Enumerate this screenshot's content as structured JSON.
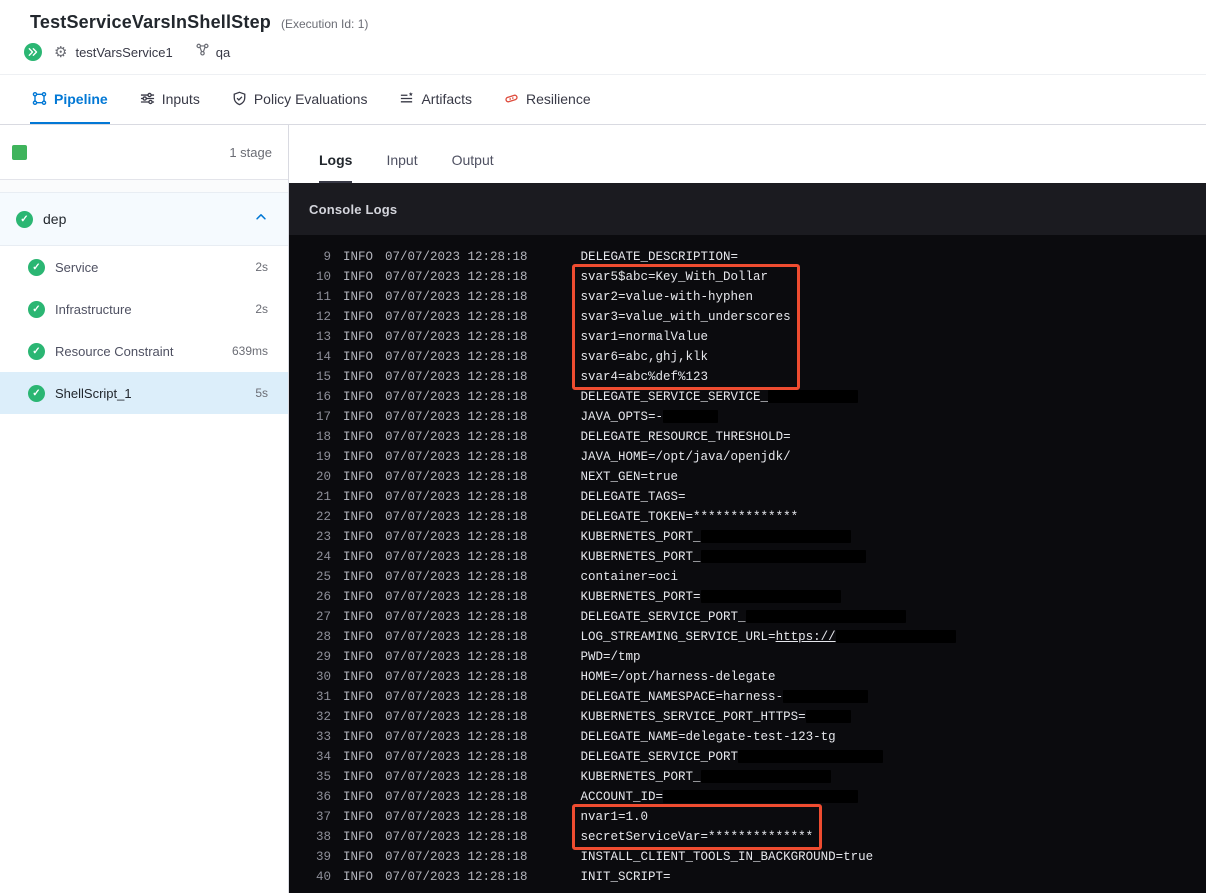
{
  "colors": {
    "accent_blue": "#0278d5",
    "success_green": "#2bb673",
    "highlight_red": "#ef4c30"
  },
  "header": {
    "title": "TestServiceVarsInShellStep",
    "execution_id": "(Execution Id: 1)",
    "service_name": "testVarsService1",
    "environment_name": "qa"
  },
  "tabs": [
    {
      "label": "Pipeline",
      "active": true
    },
    {
      "label": "Inputs",
      "active": false
    },
    {
      "label": "Policy Evaluations",
      "active": false
    },
    {
      "label": "Artifacts",
      "active": false
    },
    {
      "label": "Resilience",
      "active": false
    }
  ],
  "sidebar": {
    "stage_count": "1 stage",
    "group": {
      "label": "dep"
    },
    "items": [
      {
        "label": "Service",
        "duration": "2s",
        "selected": false
      },
      {
        "label": "Infrastructure",
        "duration": "2s",
        "selected": false
      },
      {
        "label": "Resource Constraint",
        "duration": "639ms",
        "selected": false
      },
      {
        "label": "ShellScript_1",
        "duration": "5s",
        "selected": true
      }
    ]
  },
  "console": {
    "tabs": [
      {
        "label": "Logs",
        "active": true
      },
      {
        "label": "Input",
        "active": false
      },
      {
        "label": "Output",
        "active": false
      }
    ],
    "header_label": "Console Logs",
    "highlights": [
      {
        "from": 10,
        "to": 15
      },
      {
        "from": 37,
        "to": 38
      }
    ],
    "lines": [
      {
        "n": 9,
        "level": "INFO",
        "ts": "07/07/2023 12:28:18",
        "parts": [
          {
            "text": "DELEGATE_DESCRIPTION="
          }
        ]
      },
      {
        "n": 10,
        "level": "INFO",
        "ts": "07/07/2023 12:28:18",
        "parts": [
          {
            "text": "svar5$abc=Key_With_Dollar"
          }
        ]
      },
      {
        "n": 11,
        "level": "INFO",
        "ts": "07/07/2023 12:28:18",
        "parts": [
          {
            "text": "svar2=value-with-hyphen"
          }
        ]
      },
      {
        "n": 12,
        "level": "INFO",
        "ts": "07/07/2023 12:28:18",
        "parts": [
          {
            "text": "svar3=value_with_underscores"
          }
        ]
      },
      {
        "n": 13,
        "level": "INFO",
        "ts": "07/07/2023 12:28:18",
        "parts": [
          {
            "text": "svar1=normalValue"
          }
        ]
      },
      {
        "n": 14,
        "level": "INFO",
        "ts": "07/07/2023 12:28:18",
        "parts": [
          {
            "text": "svar6=abc,ghj,klk"
          }
        ]
      },
      {
        "n": 15,
        "level": "INFO",
        "ts": "07/07/2023 12:28:18",
        "parts": [
          {
            "text": "svar4=abc%def%123"
          }
        ]
      },
      {
        "n": 16,
        "level": "INFO",
        "ts": "07/07/2023 12:28:18",
        "parts": [
          {
            "text": "DELEGATE_SERVICE_SERVICE_"
          },
          {
            "redact": 90
          }
        ]
      },
      {
        "n": 17,
        "level": "INFO",
        "ts": "07/07/2023 12:28:18",
        "parts": [
          {
            "text": "JAVA_OPTS=-"
          },
          {
            "redact": 55
          }
        ]
      },
      {
        "n": 18,
        "level": "INFO",
        "ts": "07/07/2023 12:28:18",
        "parts": [
          {
            "text": "DELEGATE_RESOURCE_THRESHOLD="
          }
        ]
      },
      {
        "n": 19,
        "level": "INFO",
        "ts": "07/07/2023 12:28:18",
        "parts": [
          {
            "text": "JAVA_HOME=/opt/java/openjdk/"
          }
        ]
      },
      {
        "n": 20,
        "level": "INFO",
        "ts": "07/07/2023 12:28:18",
        "parts": [
          {
            "text": "NEXT_GEN=true"
          }
        ]
      },
      {
        "n": 21,
        "level": "INFO",
        "ts": "07/07/2023 12:28:18",
        "parts": [
          {
            "text": "DELEGATE_TAGS="
          }
        ]
      },
      {
        "n": 22,
        "level": "INFO",
        "ts": "07/07/2023 12:28:18",
        "parts": [
          {
            "text": "DELEGATE_TOKEN=**************"
          }
        ]
      },
      {
        "n": 23,
        "level": "INFO",
        "ts": "07/07/2023 12:28:18",
        "parts": [
          {
            "text": "KUBERNETES_PORT_"
          },
          {
            "redact": 150
          }
        ]
      },
      {
        "n": 24,
        "level": "INFO",
        "ts": "07/07/2023 12:28:18",
        "parts": [
          {
            "text": "KUBERNETES_PORT_"
          },
          {
            "redact": 165
          }
        ]
      },
      {
        "n": 25,
        "level": "INFO",
        "ts": "07/07/2023 12:28:18",
        "parts": [
          {
            "text": "container=oci"
          }
        ]
      },
      {
        "n": 26,
        "level": "INFO",
        "ts": "07/07/2023 12:28:18",
        "parts": [
          {
            "text": "KUBERNETES_PORT="
          },
          {
            "redact": 140
          }
        ]
      },
      {
        "n": 27,
        "level": "INFO",
        "ts": "07/07/2023 12:28:18",
        "parts": [
          {
            "text": "DELEGATE_SERVICE_PORT_"
          },
          {
            "redact": 160
          }
        ]
      },
      {
        "n": 28,
        "level": "INFO",
        "ts": "07/07/2023 12:28:18",
        "parts": [
          {
            "text": "LOG_STREAMING_SERVICE_URL="
          },
          {
            "link": "https://"
          },
          {
            "redact": 120
          }
        ]
      },
      {
        "n": 29,
        "level": "INFO",
        "ts": "07/07/2023 12:28:18",
        "parts": [
          {
            "text": "PWD=/tmp"
          }
        ]
      },
      {
        "n": 30,
        "level": "INFO",
        "ts": "07/07/2023 12:28:18",
        "parts": [
          {
            "text": "HOME=/opt/harness-delegate"
          }
        ]
      },
      {
        "n": 31,
        "level": "INFO",
        "ts": "07/07/2023 12:28:18",
        "parts": [
          {
            "text": "DELEGATE_NAMESPACE=harness-"
          },
          {
            "redact": 85
          }
        ]
      },
      {
        "n": 32,
        "level": "INFO",
        "ts": "07/07/2023 12:28:18",
        "parts": [
          {
            "text": "KUBERNETES_SERVICE_PORT_HTTPS="
          },
          {
            "redact": 45
          }
        ]
      },
      {
        "n": 33,
        "level": "INFO",
        "ts": "07/07/2023 12:28:18",
        "parts": [
          {
            "text": "DELEGATE_NAME=delegate-test-123-tg"
          }
        ]
      },
      {
        "n": 34,
        "level": "INFO",
        "ts": "07/07/2023 12:28:18",
        "parts": [
          {
            "text": "DELEGATE_SERVICE_PORT"
          },
          {
            "redact": 145
          }
        ]
      },
      {
        "n": 35,
        "level": "INFO",
        "ts": "07/07/2023 12:28:18",
        "parts": [
          {
            "text": "KUBERNETES_PORT_"
          },
          {
            "redact": 130
          }
        ]
      },
      {
        "n": 36,
        "level": "INFO",
        "ts": "07/07/2023 12:28:18",
        "parts": [
          {
            "text": "ACCOUNT_ID="
          },
          {
            "redact": 195
          }
        ]
      },
      {
        "n": 37,
        "level": "INFO",
        "ts": "07/07/2023 12:28:18",
        "parts": [
          {
            "text": "nvar1=1.0"
          }
        ]
      },
      {
        "n": 38,
        "level": "INFO",
        "ts": "07/07/2023 12:28:18",
        "parts": [
          {
            "text": "secretServiceVar=**************"
          }
        ]
      },
      {
        "n": 39,
        "level": "INFO",
        "ts": "07/07/2023 12:28:18",
        "parts": [
          {
            "text": "INSTALL_CLIENT_TOOLS_IN_BACKGROUND=true"
          }
        ]
      },
      {
        "n": 40,
        "level": "INFO",
        "ts": "07/07/2023 12:28:18",
        "parts": [
          {
            "text": "INIT_SCRIPT="
          }
        ]
      }
    ]
  }
}
